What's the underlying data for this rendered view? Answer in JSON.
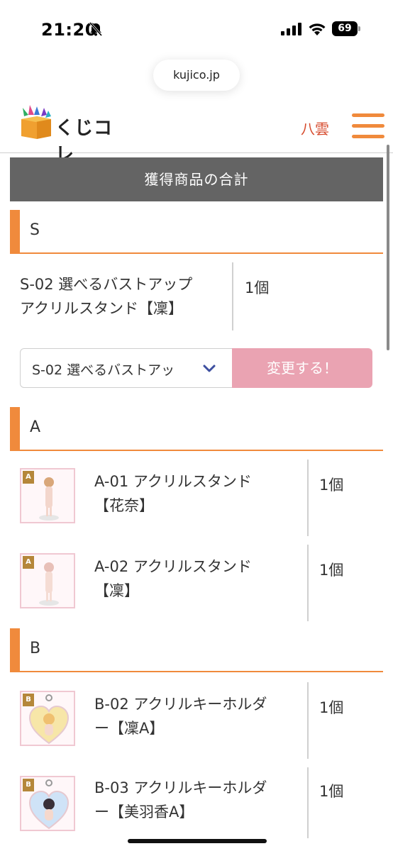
{
  "status_bar": {
    "time": "21:20",
    "battery": "69"
  },
  "browser": {
    "url": "kujico.jp"
  },
  "header": {
    "logo_text": "くじコレ",
    "user_name": "八雲"
  },
  "total_title": "獲得商品の合計",
  "sections": [
    {
      "label": "S",
      "items": [
        {
          "name_line1": "S-02 選べるバストアップ",
          "name_line2": "アクリルスタンド【凜】",
          "qty": "1個"
        }
      ],
      "select_value": "S-02 選べるバストアッ",
      "change_label": "変更する！"
    },
    {
      "label": "A",
      "items": [
        {
          "badge": "A",
          "name_line1": "A-01 アクリルスタンド",
          "name_line2": "【花奈】",
          "qty": "1個"
        },
        {
          "badge": "A",
          "name_line1": "A-02 アクリルスタンド",
          "name_line2": "【凜】",
          "qty": "1個"
        }
      ]
    },
    {
      "label": "B",
      "items": [
        {
          "badge": "B",
          "name_line1": "B-02 アクリルキーホルダ",
          "name_line2": "ー【凜A】",
          "qty": "1個"
        },
        {
          "badge": "B",
          "name_line1": "B-03 アクリルキーホルダ",
          "name_line2": "ー【美羽香A】",
          "qty": "1個"
        }
      ]
    }
  ],
  "colors": {
    "accent": "#f08a3c",
    "header_bar": "#646464",
    "button": "#eaa3b2",
    "user_name": "#d64a2c"
  },
  "icons": [
    "bell-slash-icon",
    "signal-icon",
    "wifi-icon",
    "battery-icon",
    "menu-icon",
    "chevron-down-icon"
  ]
}
